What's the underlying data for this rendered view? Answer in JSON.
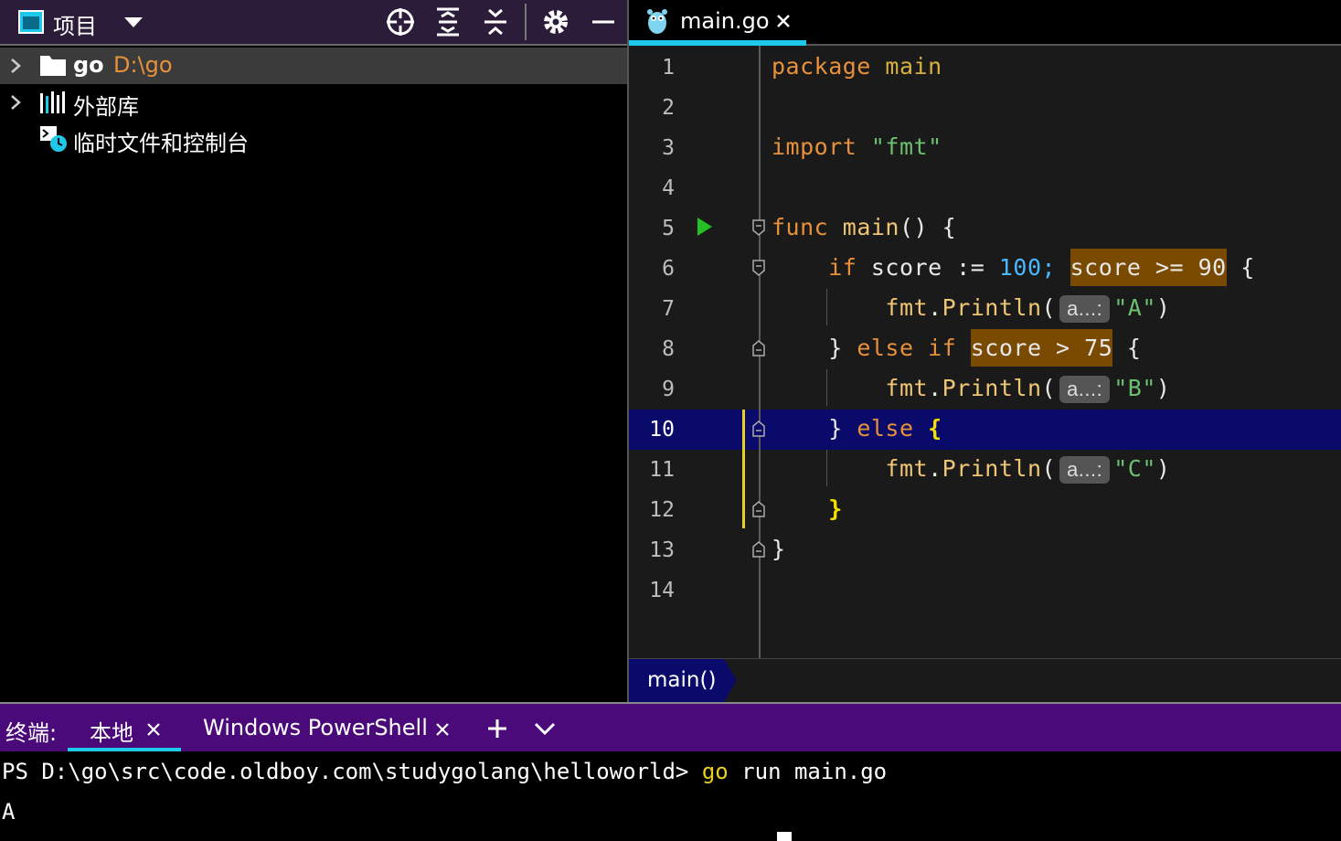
{
  "project_panel": {
    "title": "项目",
    "tree": [
      {
        "name": "go",
        "path": "D:\\go"
      },
      {
        "name": "外部库"
      },
      {
        "name": "临时文件和控制台"
      }
    ]
  },
  "editor": {
    "tab_label": "main.go",
    "line_numbers": [
      "1",
      "2",
      "3",
      "4",
      "5",
      "6",
      "7",
      "8",
      "9",
      "10",
      "11",
      "12",
      "13",
      "14"
    ],
    "code": {
      "l1_kw": "package",
      "l1_rest": " main",
      "l3_kw": "import",
      "l3_str": " \"fmt\"",
      "l5_kw": "func",
      "l5_fn": " main",
      "l5_rest": "() {",
      "l6_indent": "    ",
      "l6_kw": "if",
      "l6_a": " score := ",
      "l6_num": "100;",
      "l6_sp": " ",
      "l6_hl": "score >= 90",
      "l6_end": " {",
      "l7_indent": "        ",
      "l7_pkg": "fmt",
      "l7_dot": ".",
      "l7_fn": "Println",
      "l7_paren": "(",
      "l7_hint": "a...:",
      "l7_str": "\"A\"",
      "l7_close": ")",
      "l8_indent": "    ",
      "l8_a": "} ",
      "l8_kw": "else if",
      "l8_sp": " ",
      "l8_hl": "score > 75",
      "l8_end": " {",
      "l9_indent": "        ",
      "l9_pkg": "fmt",
      "l9_dot": ".",
      "l9_fn": "Println",
      "l9_paren": "(",
      "l9_hint": "a...:",
      "l9_str": "\"B\"",
      "l9_close": ")",
      "l10_indent": "    ",
      "l10_a": "} ",
      "l10_kw": "else",
      "l10_end": " {",
      "l11_indent": "        ",
      "l11_pkg": "fmt",
      "l11_dot": ".",
      "l11_fn": "Println",
      "l11_paren": "(",
      "l11_hint": "a...:",
      "l11_str": "\"C\"",
      "l11_close": ")",
      "l12_indent": "    ",
      "l12_brace": "}",
      "l13_brace": "}"
    },
    "current_line": "10",
    "breadcrumb": "main()"
  },
  "terminal": {
    "label": "终端:",
    "tabs": [
      "本地",
      "Windows PowerShell"
    ],
    "prompt": "PS D:\\go\\src\\code.oldboy.com\\studygolang\\helloworld>",
    "cmd_go": "go",
    "cmd_rest": " run main.go",
    "output": "A"
  },
  "colors": {
    "accent": "#1ec8e8",
    "terminal_header": "#4b0a7a",
    "keyword": "#e8913a",
    "string": "#6cc070",
    "highlight": "#7a4a00",
    "current_line": "#0a0a6a"
  }
}
